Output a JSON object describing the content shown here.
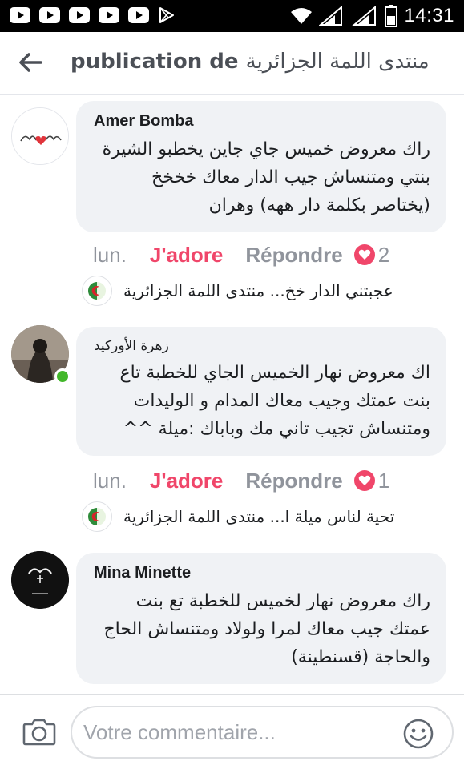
{
  "status_bar": {
    "time": "14:31",
    "colors": {
      "background": "#000000",
      "foreground": "#ffffff"
    },
    "left_icons": [
      "youtube-icon",
      "youtube-icon",
      "youtube-icon",
      "youtube-icon",
      "youtube-icon",
      "play-store-icon"
    ],
    "right_icons": [
      "wifi-icon",
      "signal-icon",
      "signal-icon",
      "battery-icon"
    ]
  },
  "header": {
    "prefix": "publication de",
    "page_name": "منتدى اللمة الجزائرية"
  },
  "colors": {
    "accent_like": "#f0466a",
    "muted": "#90949c",
    "bubble": "#f0f2f5",
    "online": "#42b72a"
  },
  "comments": [
    {
      "author": "Amer Bomba",
      "text": "راك معروض خميس جاي جاين يخطبو الشيرة بنتي ومتنساش جيب الدار معاك خخخخ (يختاصر بكلمة دار ههه) وهران",
      "date": "lun.",
      "like_label": "J'adore",
      "reply_label": "Répondre",
      "reactions": "2",
      "reply_preview": "عجبتني الدار خخ... منتدى اللمة الجزائرية"
    },
    {
      "author": "زهرة الأوركيد",
      "text": "اك معروض نهار الخميس الجاي للخطبة تاع بنت عمتك وجيب معاك المدام و الوليدات ومتنساش تجيب تاني مك وباباك :ميلة ^^",
      "date": "lun.",
      "like_label": "J'adore",
      "reply_label": "Répondre",
      "reactions": "1",
      "reply_preview": "تحية لناس ميلة ا... منتدى اللمة الجزائرية"
    },
    {
      "author": "Mina Minette",
      "text": "راك معروض نهار لخميس للخطبة تع بنت عمتك جيب معاك لمرا ولولاد ومتنساش الحاج والحاجة (قسنطينة)"
    }
  ],
  "composer": {
    "placeholder": "Votre commentaire..."
  }
}
